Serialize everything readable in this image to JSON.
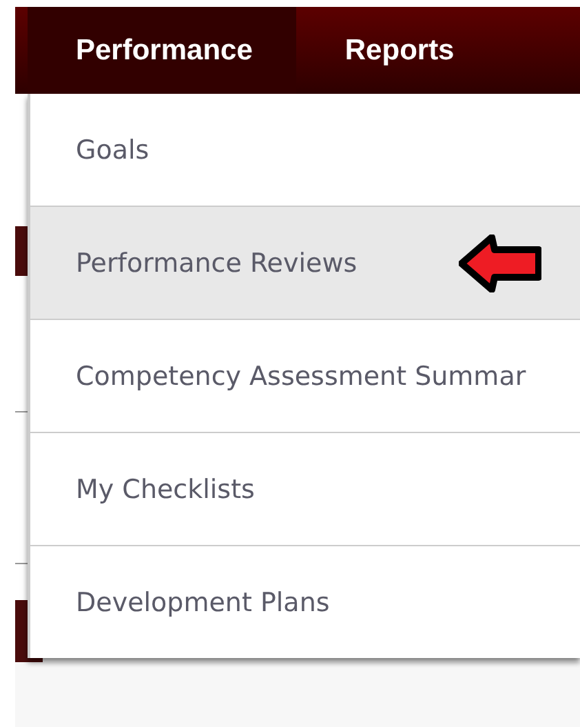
{
  "nav_tabs": [
    {
      "label": "Performance",
      "selected": true
    },
    {
      "label": "Reports",
      "selected": false
    }
  ],
  "dropdown_menu": {
    "items": [
      {
        "label": "Goals",
        "selected": false
      },
      {
        "label": "Performance Reviews",
        "selected": true
      },
      {
        "label": "Competency Assessment Summar",
        "selected": false
      },
      {
        "label": "My Checklists",
        "selected": false
      },
      {
        "label": "Development Plans",
        "selected": false
      }
    ]
  }
}
